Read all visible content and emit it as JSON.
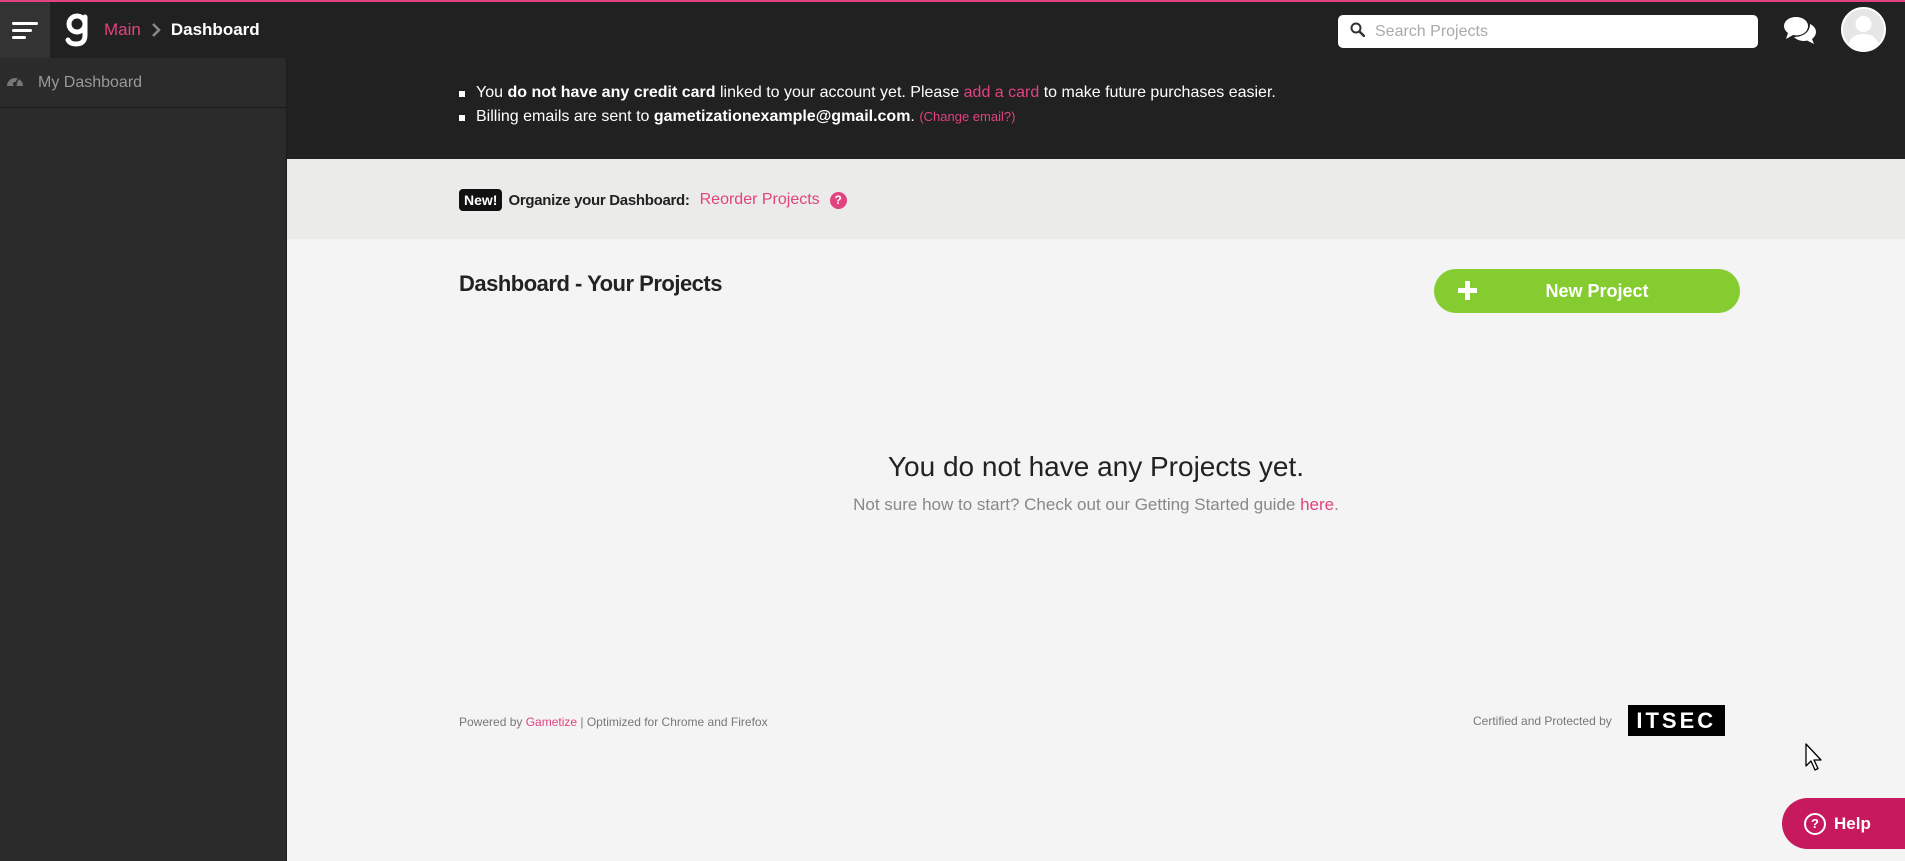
{
  "header": {
    "breadcrumb_main": "Main",
    "breadcrumb_current": "Dashboard",
    "search_placeholder": "Search Projects"
  },
  "sidebar": {
    "items": [
      {
        "label": "My Dashboard",
        "icon": "dashboard-gauge-icon"
      }
    ]
  },
  "notice": {
    "line1_prefix": "You ",
    "line1_bold": "do not have any credit card",
    "line1_mid": " linked to your account yet. Please ",
    "line1_link": "add a card",
    "line1_suffix": " to make future purchases easier.",
    "line2_prefix": "Billing emails are sent to ",
    "line2_email": "gametizationexample@gmail.com",
    "line2_dot": ". ",
    "line2_link": "(Change email?)"
  },
  "organize": {
    "badge": "New!",
    "label": "Organize your Dashboard:",
    "link": "Reorder Projects",
    "help_glyph": "?"
  },
  "main": {
    "title": "Dashboard - Your Projects",
    "new_project_label": "New Project",
    "empty_title": "You do not have any Projects yet.",
    "empty_sub_prefix": "Not sure how to start? Check out our Getting Started guide ",
    "empty_sub_link": "here",
    "empty_sub_suffix": "."
  },
  "footer": {
    "powered_prefix": "Powered by ",
    "powered_link": "Gametize",
    "powered_suffix": " | Optimized for Chrome and Firefox",
    "certified": "Certified and Protected by",
    "itsec_logo": "ITSEC"
  },
  "help_widget": {
    "label": "Help"
  },
  "colors": {
    "accent_pink": "#e0437e",
    "green": "#84cc30",
    "help_magenta": "#c7195d",
    "dark": "#212121"
  }
}
